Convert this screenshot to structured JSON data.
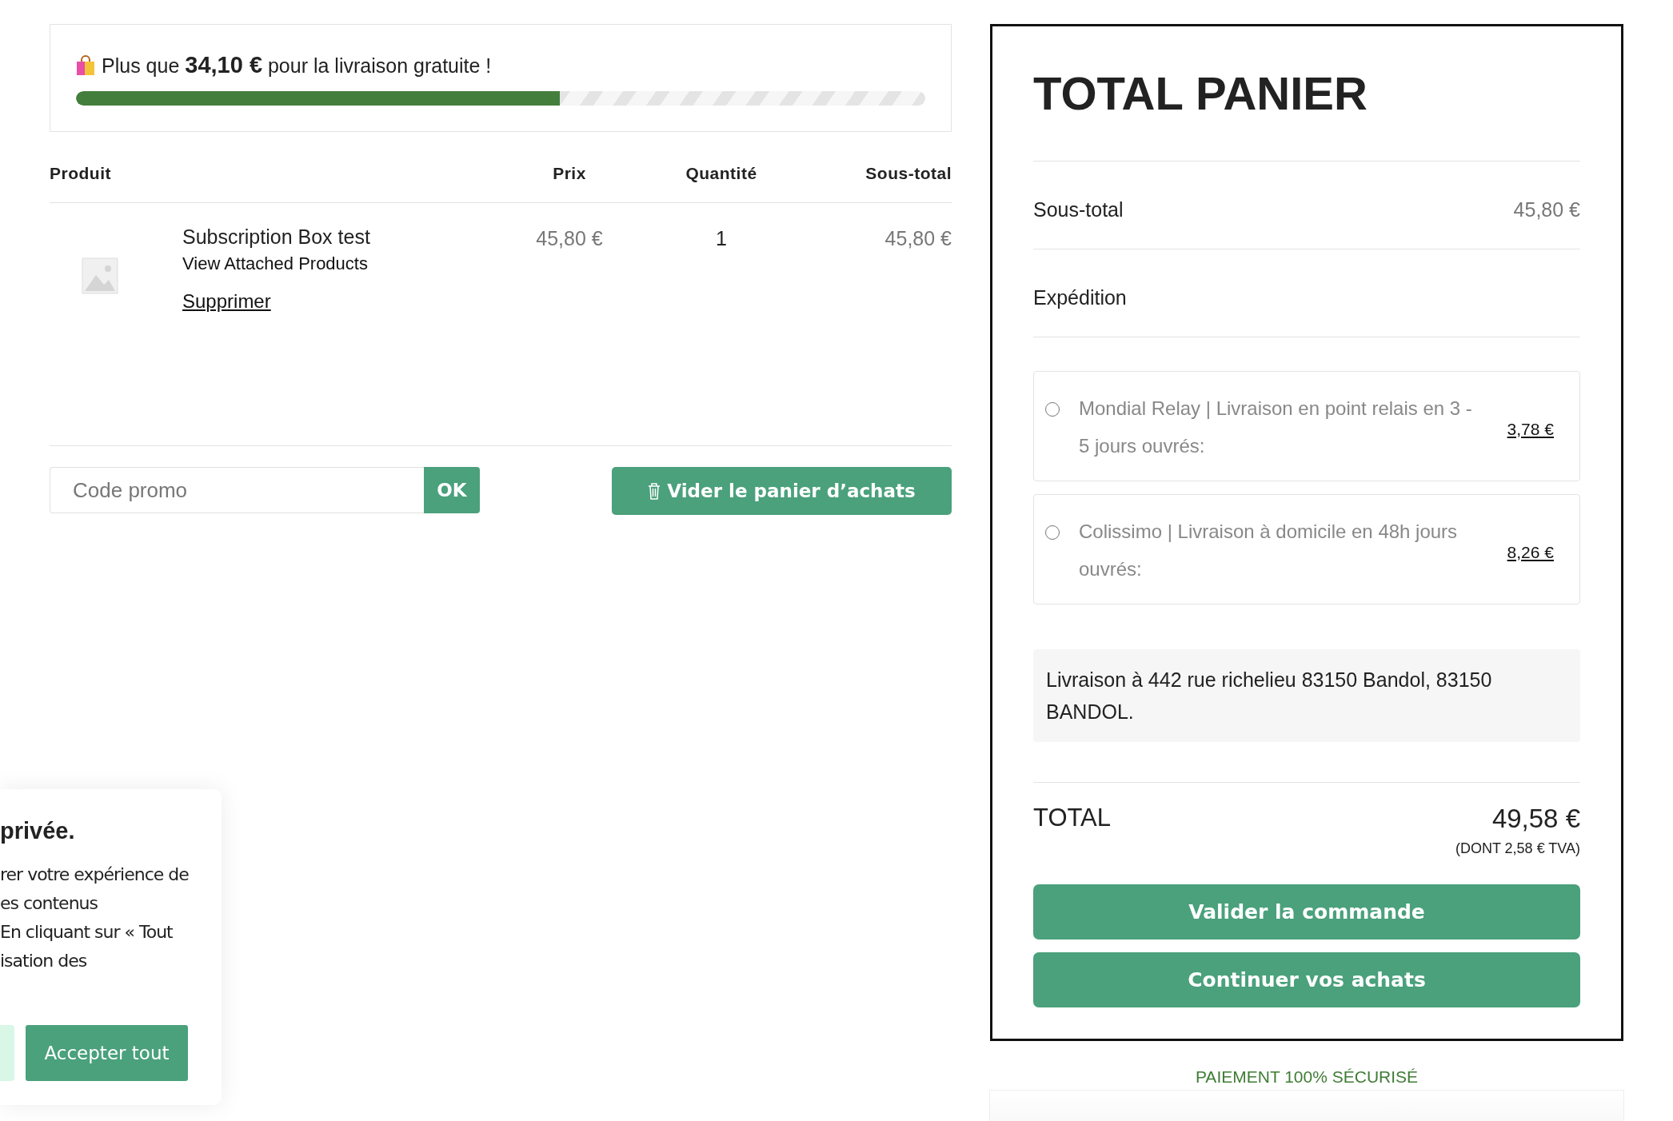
{
  "free_shipping": {
    "message": "Plus que **34,10 €** pour la livraison gratuite !",
    "level": 0.57
  },
  "cart_table": {
    "columns": [
      "Produit",
      "Prix",
      "Quantité",
      "Sous-total"
    ],
    "rows": [
      {
        "name": "Subscription Box test",
        "attached_link": "View Attached Products",
        "remove_link": "Supprimer",
        "price": "45,80 €",
        "quantity": "1",
        "subtotal": "45,80 €"
      }
    ]
  },
  "coupon": {
    "placeholder": "Code promo",
    "apply_button": "OK"
  },
  "empty_cart_button": "Vider le panier d’achats",
  "totals": {
    "title": "TOTAL PANIER",
    "subtotal_label": "Sous-total",
    "subtotal_value": "45,80 €",
    "shipping_label": "Expédition",
    "shipping_options": [
      {
        "label": "Mondial Relay | Livraison en point relais en 3 - 5 jours ouvrés:",
        "price": "3,78 €",
        "selected": false
      },
      {
        "label": "Colissimo | Livraison à domicile en 48h jours ouvrés:",
        "price": "8,26 €",
        "selected": false
      }
    ],
    "address": "Livraison à 442 rue richelieu 83150 Bandol, 83150 BANDOL.",
    "total_label": "TOTAL",
    "total_value": "49,58 €",
    "tax_note": "(DONT 2,58 € TVA)",
    "buttons": [
      "Valider la commande",
      "Continuer vos achats"
    ]
  },
  "secure_note": "PAIEMENT 100% SÉCURISÉ",
  "cookie_banner": {
    "title": "privée.",
    "lines": [
      "rer votre expérience de",
      "es contenus",
      "En cliquant sur « Tout",
      "isation des"
    ],
    "accept_button": "Accepter tout"
  }
}
